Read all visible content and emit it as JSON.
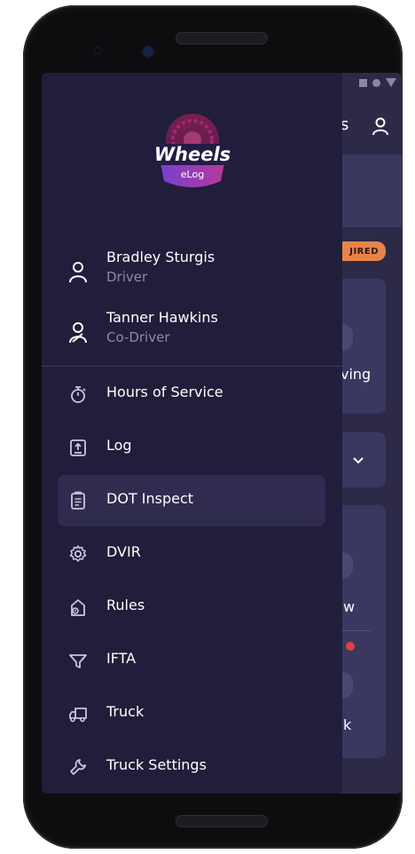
{
  "app": {
    "logo_text": "Wheels",
    "logo_subtext": "eLog"
  },
  "background": {
    "title_fragment": "is",
    "badge_fragment": "JIRED",
    "card1_text": "ving",
    "card3_text1": "w",
    "card3_text2": "k"
  },
  "users": [
    {
      "name": "Bradley Sturgis",
      "role": "Driver",
      "icon": "user-icon"
    },
    {
      "name": "Tanner Hawkins",
      "role": "Co-Driver",
      "icon": "co-driver-icon"
    }
  ],
  "menu": [
    {
      "label": "Hours of Service",
      "icon": "stopwatch-icon",
      "active": false
    },
    {
      "label": "Log",
      "icon": "upload-doc-icon",
      "active": false
    },
    {
      "label": "DOT Inspect",
      "icon": "clipboard-icon",
      "active": true
    },
    {
      "label": "DVIR",
      "icon": "gear-icon",
      "active": false
    },
    {
      "label": "Rules",
      "icon": "rules-icon",
      "active": false
    },
    {
      "label": "IFTA",
      "icon": "fuel-funnel-icon",
      "active": false
    },
    {
      "label": "Truck",
      "icon": "truck-icon",
      "active": false
    },
    {
      "label": "Truck Settings",
      "icon": "wrench-icon",
      "active": false
    }
  ],
  "colors": {
    "drawer_bg": "#201e3a",
    "screen_bg": "#2d2a48",
    "active_item_bg": "#2f2c4f",
    "accent_orange": "#e8844a",
    "logo_purple": "#8a3fc4",
    "logo_pink": "#c2308c"
  }
}
